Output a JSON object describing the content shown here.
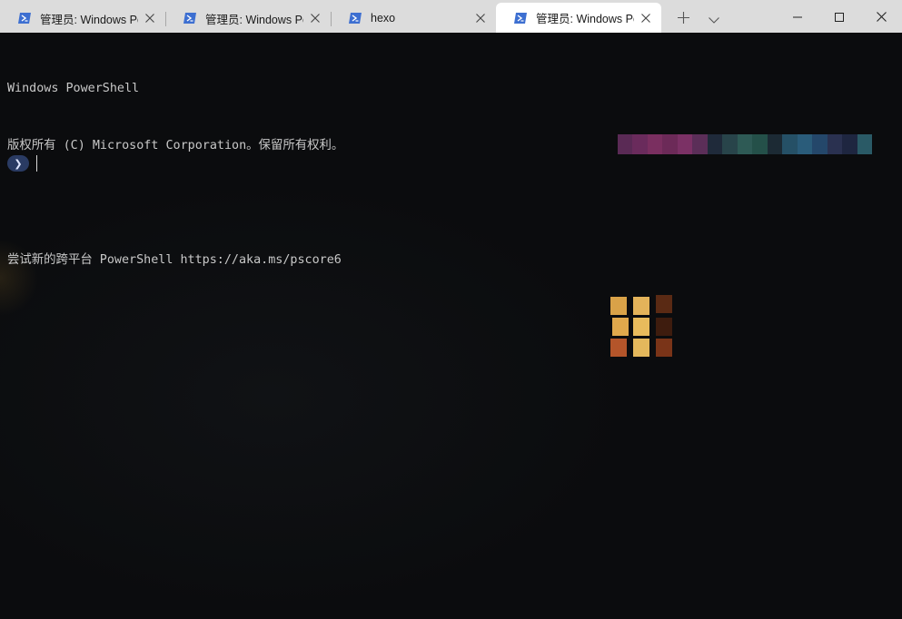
{
  "tabs": [
    {
      "title": "管理员: Windows PowerShell",
      "active": false
    },
    {
      "title": "管理员: Windows PowerShell",
      "active": false
    },
    {
      "title": "hexo",
      "active": false
    },
    {
      "title": "管理员: Windows PowerShell",
      "active": true
    }
  ],
  "titlebar": {
    "new_tab_icon": "plus-icon",
    "dropdown_icon": "chevron-down-icon",
    "minimize_icon": "minimize-icon",
    "maximize_icon": "maximize-icon",
    "close_icon": "close-icon"
  },
  "terminal": {
    "lines": [
      "Windows PowerShell",
      "版权所有 (C) Microsoft Corporation。保留所有权利。",
      "",
      "尝试新的跨平台 PowerShell https://aka.ms/pscore6"
    ],
    "prompt_symbol": "❯"
  },
  "colors": {
    "titlebar_bg": "#dcdcdc",
    "active_tab_bg": "#ffffff",
    "terminal_bg": "#0c0c0c",
    "terminal_text": "#c8c8c8",
    "powershell_icon": "#3d6fd1",
    "prompt_pill": "#2a3b63"
  }
}
